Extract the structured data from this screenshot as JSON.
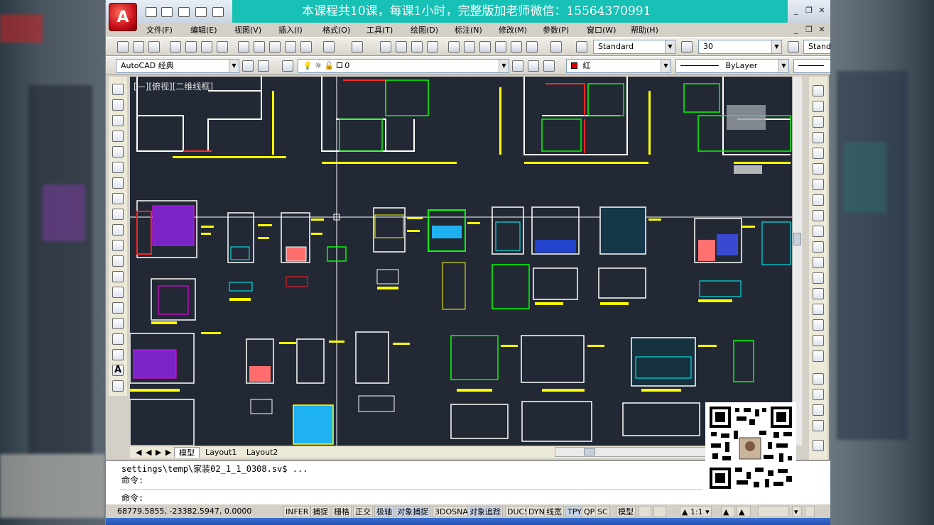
{
  "banner": {
    "text": "本课程共10课，每课1小时，完整版加老师微信：15564370991"
  },
  "menu": {
    "items": [
      "文件(F)",
      "编辑(E)",
      "视图(V)",
      "插入(I)",
      "格式(O)",
      "工具(T)",
      "绘图(D)",
      "标注(N)",
      "修改(M)",
      "参数(P)",
      "窗口(W)",
      "帮助(H)"
    ]
  },
  "toolbar": {
    "text_style": "Standard",
    "text_height": "30",
    "dim_style": "Stand"
  },
  "layers": {
    "workspace": "AutoCAD 经典",
    "current_layer": "0",
    "color": "红",
    "linetype": "ByLayer"
  },
  "viewport": {
    "label": "[—][俯视][二维线框]"
  },
  "tabs": [
    "模型",
    "Layout1",
    "Layout2"
  ],
  "command": {
    "line1": "settings\\temp\\家装02_1_1_0308.sv$ ...",
    "line2": "命令:",
    "prompt": "命令:"
  },
  "status": {
    "coords": "68779.5855, -23382.5947, 0.0000",
    "toggles": [
      "INFER",
      "捕捉",
      "栅格",
      "正交",
      "极轴",
      "对象捕捉",
      "3DOSNAP",
      "对象追踪",
      "DUCS",
      "DYN",
      "线宽",
      "TPY",
      "QP",
      "SC"
    ],
    "model": "模型",
    "scale": "1:1"
  },
  "colors": {
    "canvas_bg": "#222935",
    "banner_bg": "#17c1b5",
    "cad_yellow": "#ffff00",
    "cad_cyan": "#00ffff",
    "cad_green": "#00ff00",
    "cad_magenta": "#ff00ff",
    "cad_red": "#ff0000",
    "layer_red": "#ff0000"
  }
}
